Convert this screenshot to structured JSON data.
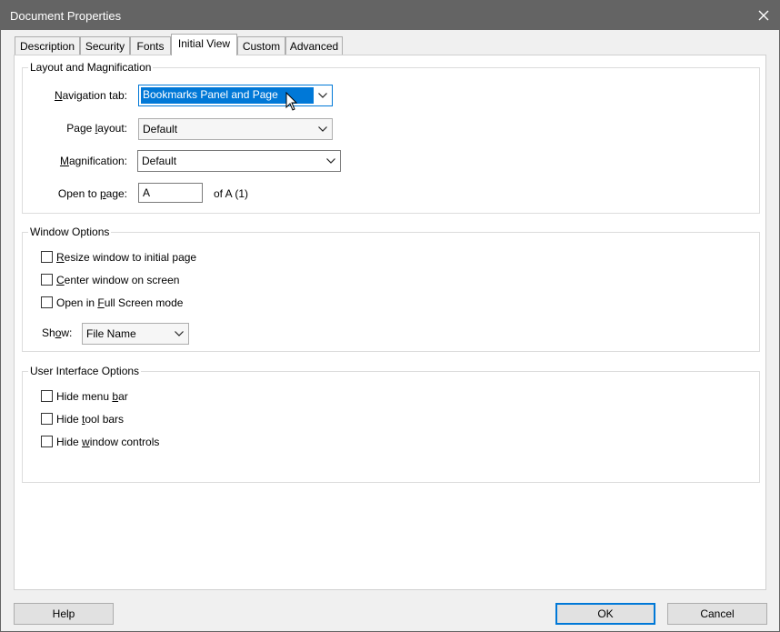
{
  "window": {
    "title": "Document Properties",
    "close_icon": "close-icon"
  },
  "tabs": [
    {
      "label": "Description"
    },
    {
      "label": "Security"
    },
    {
      "label": "Fonts"
    },
    {
      "label": "Initial View",
      "active": true
    },
    {
      "label": "Custom"
    },
    {
      "label": "Advanced"
    }
  ],
  "layout_group": {
    "title": "Layout and Magnification",
    "navigation_tab": {
      "label_u": "N",
      "label_rest": "avigation tab:",
      "value": "Bookmarks Panel and Page"
    },
    "page_layout": {
      "label_pre": "Page ",
      "label_u": "l",
      "label_rest": "ayout:",
      "value": "Default"
    },
    "magnification": {
      "label_u": "M",
      "label_rest": "agnification:",
      "value": "Default"
    },
    "open_to_page": {
      "label_pre": "Open to ",
      "label_u": "p",
      "label_rest": "age:",
      "value": "A",
      "suffix": "of A (1)"
    }
  },
  "window_group": {
    "title": "Window Options",
    "resize": {
      "u": "R",
      "rest": "esize window to initial page",
      "checked": false
    },
    "center": {
      "u": "C",
      "rest": "enter window on screen",
      "checked": false
    },
    "fullscreen": {
      "pre": "Open in ",
      "u": "F",
      "rest": "ull Screen mode",
      "checked": false
    },
    "show": {
      "label_pre": "Sh",
      "label_u": "o",
      "label_rest": "w:",
      "value": "File Name"
    }
  },
  "ui_group": {
    "title": "User Interface Options",
    "hide_menu": {
      "pre": "Hide menu ",
      "u": "b",
      "rest": "ar",
      "checked": false
    },
    "hide_tool": {
      "pre": "Hide ",
      "u": "t",
      "rest": "ool bars",
      "checked": false
    },
    "hide_window": {
      "pre": "Hide ",
      "u": "w",
      "rest": "indow controls",
      "checked": false
    }
  },
  "buttons": {
    "help": "Help",
    "ok": "OK",
    "cancel": "Cancel"
  },
  "colors": {
    "titlebar": "#646464",
    "accent": "#0078d7"
  }
}
